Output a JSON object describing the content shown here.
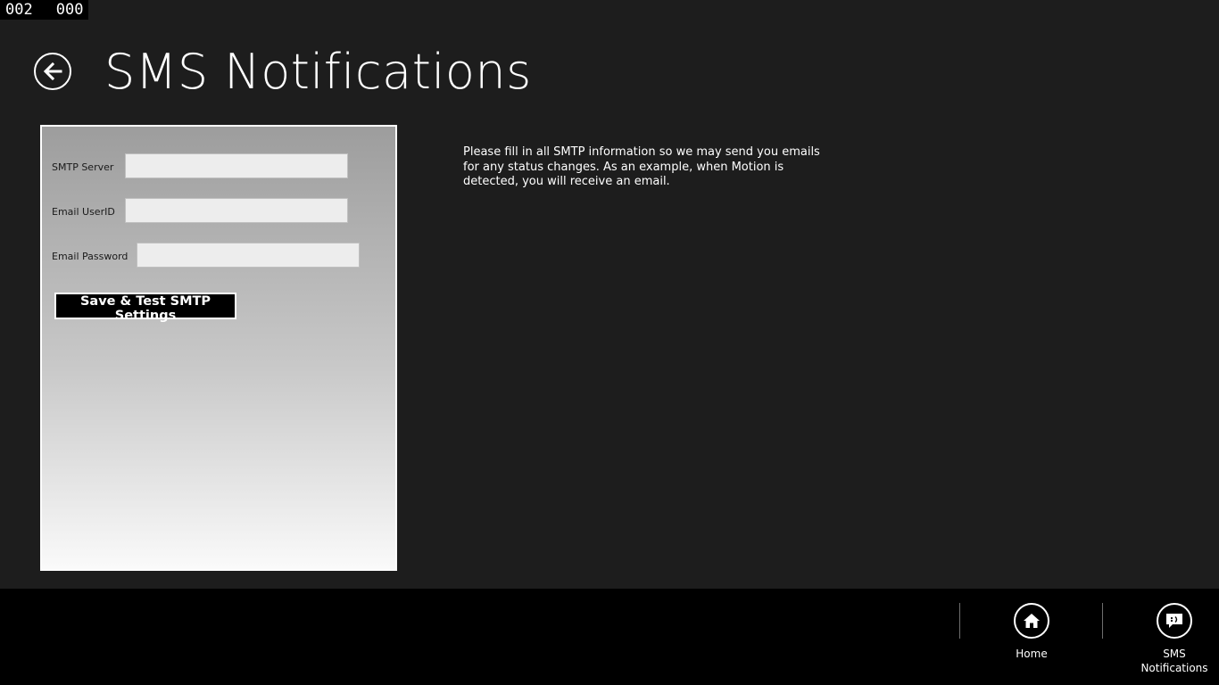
{
  "counter": {
    "left": "002",
    "right": "000"
  },
  "header": {
    "title": "SMS Notifications",
    "back_icon": "back-arrow-icon"
  },
  "form": {
    "smtp_server": {
      "label": "SMTP Server",
      "value": ""
    },
    "email_userid": {
      "label": "Email UserID",
      "value": ""
    },
    "email_password": {
      "label": "Email Password",
      "value": ""
    },
    "save_button_label": "Save & Test SMTP Settings"
  },
  "description": "Please fill in all SMTP information so we may send you emails for any status changes. As an example, when Motion is detected, you will receive an email.",
  "app_bar": {
    "buttons": [
      {
        "label": "Home",
        "icon": "home-icon"
      },
      {
        "label": "SMS\nNotifications",
        "icon": "sms-notifications-icon"
      }
    ]
  },
  "colors": {
    "background": "#1d1d1d",
    "app_bar": "#000000",
    "panel_gradient_top": "#9d9d9d",
    "panel_gradient_bottom": "#fafafa",
    "input_fill": "#ededed"
  }
}
